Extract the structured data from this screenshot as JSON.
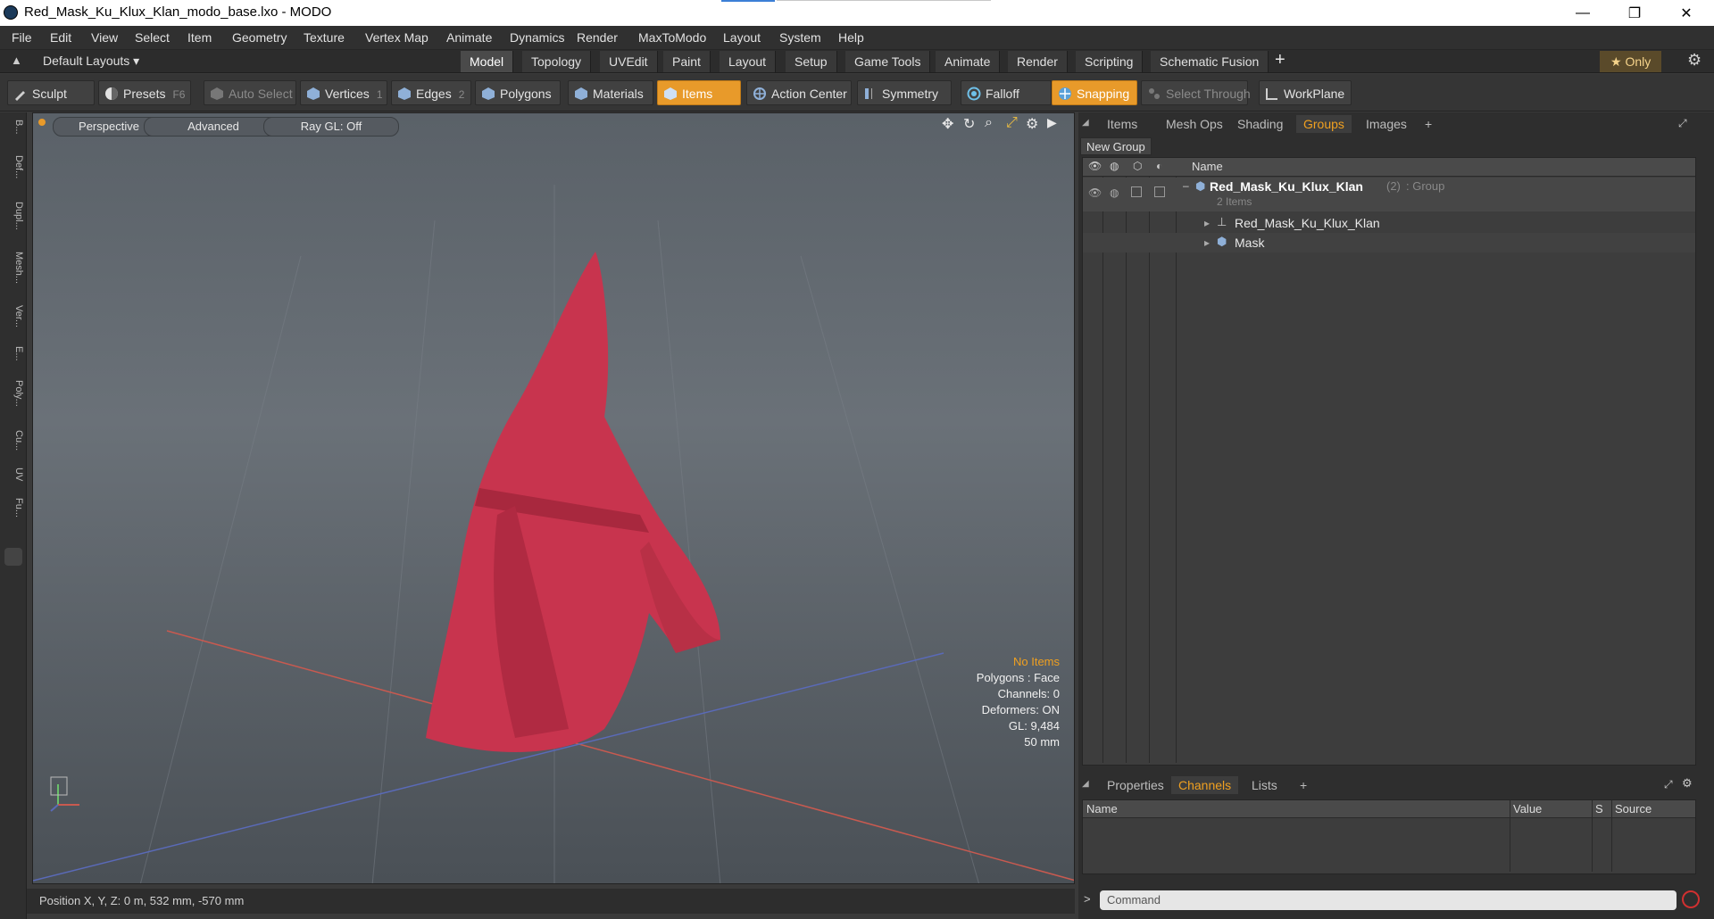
{
  "window": {
    "title": "Red_Mask_Ku_Klux_Klan_modo_base.lxo - MODO",
    "controls": [
      "—",
      "❐",
      "✕"
    ]
  },
  "menu": [
    "File",
    "Edit",
    "View",
    "Select",
    "Item",
    "Geometry",
    "Texture",
    "Vertex Map",
    "Animate",
    "Dynamics",
    "Render",
    "MaxToModo",
    "Layout",
    "System",
    "Help"
  ],
  "layout": {
    "selector": "Default Layouts ▾",
    "tabs": [
      "Model",
      "Topology",
      "UVEdit",
      "Paint",
      "Layout",
      "Setup",
      "Game Tools",
      "Animate",
      "Render",
      "Scripting",
      "Schematic Fusion"
    ],
    "active_tab": "Model",
    "add": "+",
    "only_label": "★  Only"
  },
  "toolbar": {
    "sculpt": "Sculpt",
    "presets": "Presets",
    "presets_key": "F6",
    "auto_select": "Auto Select",
    "vertices": "Vertices",
    "vertices_count": "1",
    "edges": "Edges",
    "edges_count": "2",
    "polygons": "Polygons",
    "materials": "Materials",
    "items": "Items",
    "action_center": "Action Center",
    "symmetry": "Symmetry",
    "falloff": "Falloff",
    "snapping": "Snapping",
    "select_through": "Select Through",
    "workplane": "WorkPlane"
  },
  "left_tabs": [
    "B...",
    "Def...",
    "Dupl...",
    "Mesh...",
    "Ver...",
    "E...",
    "Poly...",
    "Cu...",
    "UV",
    "Fu..."
  ],
  "viewport": {
    "view_mode": "Perspective",
    "shading": "Advanced",
    "raygl": "Ray GL: Off",
    "stats": {
      "selection": "No Items",
      "polygons": "Polygons : Face",
      "channels": "Channels: 0",
      "deformers": "Deformers: ON",
      "gl": "GL: 9,484",
      "scale": "50 mm"
    }
  },
  "status": {
    "position": "Position X, Y, Z:   0 m, 532 mm, -570 mm"
  },
  "panel_top": {
    "tabs": [
      "Items",
      "Mesh Ops",
      "Shading",
      "Groups",
      "Images"
    ],
    "active_tab": "Groups",
    "add": "+",
    "new_group": "New Group",
    "column_name": "Name",
    "group": {
      "name": "Red_Mask_Ku_Klux_Klan",
      "count": "(2)",
      "type": ": Group",
      "sub": "2 Items"
    },
    "children": [
      "Red_Mask_Ku_Klux_Klan",
      "Mask"
    ]
  },
  "panel_bottom": {
    "tabs": [
      "Properties",
      "Channels",
      "Lists"
    ],
    "active_tab": "Channels",
    "add": "+",
    "columns": [
      "Name",
      "Value",
      "S",
      "Source"
    ],
    "command_placeholder": "Command",
    "prompt": ">"
  },
  "colors": {
    "accent": "#e89a2a",
    "active_tab_text": "#f0a020",
    "mesh": "#c8344e"
  }
}
